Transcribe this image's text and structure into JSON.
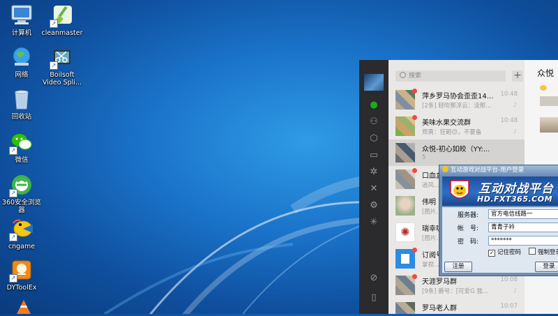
{
  "desktop": {
    "icons": [
      {
        "label": "计算机",
        "icon": "computer-icon"
      },
      {
        "label": "cleanmaster",
        "icon": "broom-icon"
      },
      {
        "label": "网络",
        "icon": "network-globe-icon"
      },
      {
        "label": "Boilsoft Video Spli...",
        "icon": "scissors-video-icon"
      },
      {
        "label": "回收站",
        "icon": "recycle-bin-icon"
      },
      {
        "label": "微信",
        "icon": "wechat-icon"
      },
      {
        "label": "360安全浏览器",
        "icon": "360-browser-icon"
      },
      {
        "label": "cngame",
        "icon": "cngame-icon"
      },
      {
        "label": "DYToolEx",
        "icon": "dytoolex-icon"
      }
    ]
  },
  "wechat": {
    "search_placeholder": "搜索",
    "add_button": "+",
    "chat_title": "众悦",
    "chats": [
      {
        "name": "萍乡罗马协会歪歪14...",
        "preview": "[2条] 轻吹那浮云：没那...",
        "time": "10:48",
        "unread": true
      },
      {
        "name": "美味水果交流群",
        "preview": "郑勇：狂砸😊，不要备",
        "time": "10:48",
        "unread": true
      },
      {
        "name": "众悦-初心如皎（YY:...",
        "preview": "5",
        "time": "",
        "unread": false,
        "selected": true
      },
      {
        "name": "口血盒",
        "preview": "逍风...",
        "time": "",
        "unread": true
      },
      {
        "name": "伟明",
        "preview": "[图片...",
        "time": "",
        "unread": false
      },
      {
        "name": "瑞幸咖",
        "preview": "[图片...",
        "time": "",
        "unread": false
      },
      {
        "name": "订阅号",
        "preview": "掌视...",
        "time": "",
        "unread": true
      },
      {
        "name": "天涯罗马群",
        "preview": "[9条] 爵号：[可爱G 我...",
        "time": "10:08",
        "unread": true
      },
      {
        "name": "罗马老人群",
        "preview": "",
        "time": "10:07",
        "unread": false
      }
    ],
    "colors": {
      "nav": "#2b2b2d",
      "list": "#e9e8e7",
      "accent": "#1aad19",
      "badge": "#f04a3a"
    }
  },
  "login_dialog": {
    "title": "互动游戏对战平台-用户登录",
    "brand_cn": "互动对战平台",
    "brand_url": "HD.FXT365.COM",
    "server_label": "服务器:",
    "server_value": "官方电信线路一",
    "account_label": "帐　号:",
    "account_value": "青青子衿",
    "password_label": "密　码:",
    "password_value": "*******",
    "remember_label": "记住密码",
    "remember_checked": true,
    "force_label": "强制登录",
    "force_checked": false,
    "register_button": "注册",
    "login_button": "登录"
  }
}
